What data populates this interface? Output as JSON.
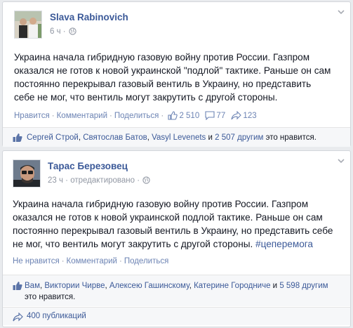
{
  "posts": [
    {
      "author": "Slava Rabinovich",
      "time": "6 ч",
      "edited": "",
      "text_lines": [
        "Украина начала гибридную газовую войну против России. Газпром",
        "оказался не готов к новой украинской \"подлой\" тактике. Раньше он сам",
        "постоянно перекрывал газовый вентиль в Украину, но представить",
        "себе не мог, что вентиль могут закрутить с другой стороны."
      ],
      "actions": {
        "like": "Нравится",
        "comment": "Комментарий",
        "share": "Поделиться"
      },
      "counts": {
        "likes": "2 510",
        "comments": "77",
        "shares": "123"
      },
      "likes_line": [
        "Сергей Строй",
        "Святослав Батов",
        "Vasyl Levenets",
        "2 507 другим"
      ],
      "likes_suffix": "это нравится."
    },
    {
      "author": "Тарас Березовец",
      "time": "23 ч",
      "edited": "отредактировано",
      "text_lines": [
        "Украина начала гибридную газовую войну против России. Газпром",
        "оказался не готов к новой украинской подлой тактике. Раньше он сам",
        "постоянно перекрывал газовый вентиль в Украину, но представить себе",
        "не мог, что вентиль могут закрутить с другой стороны."
      ],
      "hashtag": "#цеперемога",
      "actions": {
        "like": "Не нравится",
        "comment": "Комментарий",
        "share": "Поделиться"
      },
      "likes_line": [
        "Вам",
        "Виктории Чирве",
        "Алексею Гашинскому",
        "Катерине Городниче",
        "5 598 другим"
      ],
      "likes_suffix": "это нравится.",
      "shares_text": "400 публикаций"
    }
  ],
  "colors": {
    "link": "#3b5998",
    "muted": "#9197a3",
    "action": "#6d84b4",
    "bg": "#e9ebee"
  }
}
